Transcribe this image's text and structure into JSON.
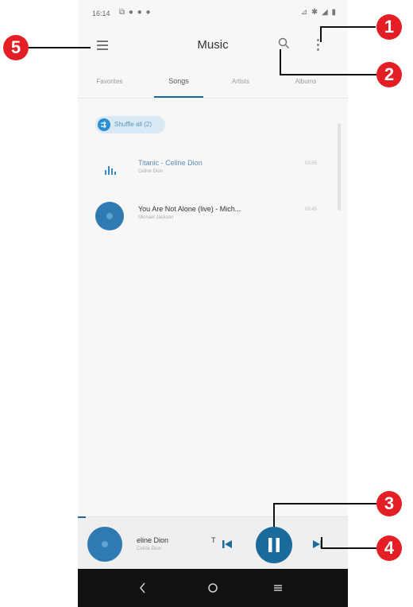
{
  "status_bar": {
    "time": "16:14",
    "left_icons": "⧉ ● ● ●",
    "right_icons": "⊿ ✱ ◢ ▮"
  },
  "app_bar": {
    "title": "Music"
  },
  "tabs": [
    {
      "label": "Favorites",
      "active": false
    },
    {
      "label": "Songs",
      "active": true
    },
    {
      "label": "Artists",
      "active": false
    },
    {
      "label": "Albums",
      "active": false
    }
  ],
  "shuffle": {
    "label": "Shuffle all (2)"
  },
  "songs": [
    {
      "title": "Titanic - Celine Dion",
      "subtitle": "Celine Dion",
      "duration": "03:55",
      "playing": true
    },
    {
      "title": "You Are Not Alone (live) - Mich...",
      "subtitle": "Michael Jackson",
      "duration": "05:45",
      "playing": false
    }
  ],
  "mini_player": {
    "title": "eline Dion",
    "subtitle": "Celine Dion",
    "extra": "T"
  },
  "callouts": [
    "1",
    "2",
    "3",
    "4",
    "5"
  ],
  "colors": {
    "accent": "#1a6b9c",
    "callout": "#e31e24"
  }
}
